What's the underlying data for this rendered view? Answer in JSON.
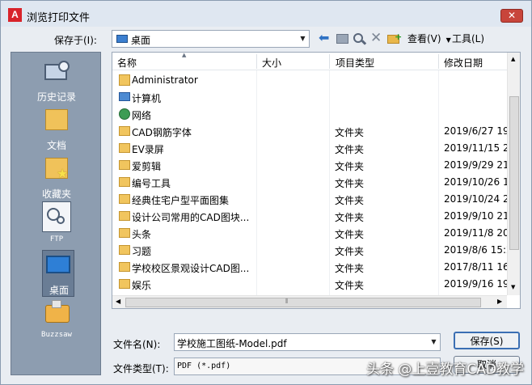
{
  "window": {
    "title": "浏览打印文件",
    "close_glyph": "✕",
    "app_icon_glyph": "A"
  },
  "lookin": {
    "label": "保存于(I):",
    "value": "桌面"
  },
  "toolbar": {
    "views_label": "查看(V)",
    "tools_label": "工具(L)"
  },
  "places": [
    {
      "label": "历史记录",
      "icon": "history-icon"
    },
    {
      "label": "文档",
      "icon": "documents-folder-icon"
    },
    {
      "label": "收藏夹",
      "icon": "favorites-folder-icon"
    },
    {
      "label": "FTP",
      "icon": "ftp-icon"
    },
    {
      "label": "桌面",
      "icon": "desktop-icon"
    },
    {
      "label": "Buzzsaw",
      "icon": "buzzsaw-icon"
    }
  ],
  "columns": {
    "name": "名称",
    "size": "大小",
    "type": "项目类型",
    "modified": "修改日期"
  },
  "files": [
    {
      "name": "Administrator",
      "type": "",
      "modified": "",
      "icon": "user-folder-icon"
    },
    {
      "name": "计算机",
      "type": "",
      "modified": "",
      "icon": "computer-icon"
    },
    {
      "name": "网络",
      "type": "",
      "modified": "",
      "icon": "network-icon"
    },
    {
      "name": "CAD钢筋字体",
      "type": "文件夹",
      "modified": "2019/6/27 19",
      "icon": "folder-icon"
    },
    {
      "name": "EV录屏",
      "type": "文件夹",
      "modified": "2019/11/15 2",
      "icon": "folder-icon"
    },
    {
      "name": "爱剪辑",
      "type": "文件夹",
      "modified": "2019/9/29 21",
      "icon": "folder-icon"
    },
    {
      "name": "编号工具",
      "type": "文件夹",
      "modified": "2019/10/26 1",
      "icon": "folder-icon"
    },
    {
      "name": "经典住宅户型平面图集",
      "type": "文件夹",
      "modified": "2019/10/24 2",
      "icon": "folder-icon"
    },
    {
      "name": "设计公司常用的CAD图块...",
      "type": "文件夹",
      "modified": "2019/9/10 21",
      "icon": "folder-icon"
    },
    {
      "name": "头条",
      "type": "文件夹",
      "modified": "2019/11/8 20",
      "icon": "folder-icon"
    },
    {
      "name": "习题",
      "type": "文件夹",
      "modified": "2019/8/6 15:2",
      "icon": "folder-icon"
    },
    {
      "name": "学校校区景观设计CAD图...",
      "type": "文件夹",
      "modified": "2017/8/11 16",
      "icon": "folder-icon"
    },
    {
      "name": "娱乐",
      "type": "文件夹",
      "modified": "2019/9/16 19",
      "icon": "folder-icon"
    }
  ],
  "filename": {
    "label": "文件名(N):",
    "value": "学校施工图纸-Model.pdf"
  },
  "filetype": {
    "label": "文件类型(T):",
    "value": "PDF (*.pdf)"
  },
  "buttons": {
    "save": "保存(S)",
    "cancel": "取消"
  },
  "watermark": "头条 @上壹教育CAD教学",
  "colors": {
    "places_bg": "#8d9db0",
    "window_bg": "#e9edf2",
    "close_button": "#c8453b"
  }
}
